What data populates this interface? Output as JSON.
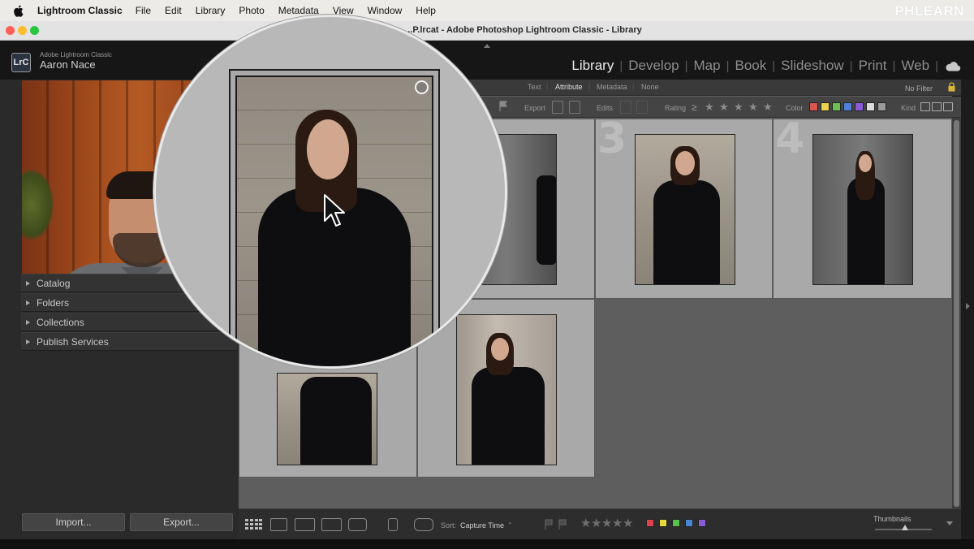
{
  "menubar": {
    "app": "Lightroom Classic",
    "items": [
      "File",
      "Edit",
      "Library",
      "Photo",
      "Metadata",
      "View",
      "Window",
      "Help"
    ],
    "brand": "PHLEARN"
  },
  "window": {
    "title": "...P.lrcat - Adobe Photoshop Lightroom Classic - Library"
  },
  "identity": {
    "logo": "LrC",
    "app_subtitle": "Adobe Lightroom Classic",
    "user": "Aaron Nace"
  },
  "modules": {
    "items": [
      "Library",
      "Develop",
      "Map",
      "Book",
      "Slideshow",
      "Print",
      "Web"
    ],
    "active": "Library",
    "cloud_icon": "cloud-icon"
  },
  "left_panel": {
    "sections": [
      "Catalog",
      "Folders",
      "Collections",
      "Publish Services"
    ],
    "import_label": "Import...",
    "export_label": "Export..."
  },
  "filter_bar": {
    "tabs": [
      "Text",
      "Attribute",
      "Metadata",
      "None"
    ],
    "active_tab": "Attribute",
    "preset": "No Filter"
  },
  "attribute_bar": {
    "export_label": "Export",
    "edits_label": "Edits",
    "rating_label": "Rating",
    "rating_op": "≥",
    "color_label": "Color",
    "kind_label": "Kind",
    "colors": [
      "#d9534f",
      "#e8d44d",
      "#6cbf4f",
      "#4f7fd9",
      "#8a5bd6",
      "#dcdcdc",
      "#9a9a9a"
    ]
  },
  "grid": {
    "cells": [
      {
        "num": "",
        "scene": "dark"
      },
      {
        "num": "3",
        "scene": "light"
      },
      {
        "num": "4",
        "scene": "dark-wide"
      },
      {
        "num": "",
        "scene": "light"
      },
      {
        "num": "",
        "scene": "column"
      }
    ]
  },
  "toolbar": {
    "sort_label": "Sort:",
    "sort_value": "Capture Time",
    "thumbnails_label": "Thumbnails",
    "thumbnail_size": 0.53,
    "label_colors": [
      "#e0424b",
      "#e6d93c",
      "#58c24c",
      "#4a86d6",
      "#8a5bd6"
    ]
  }
}
